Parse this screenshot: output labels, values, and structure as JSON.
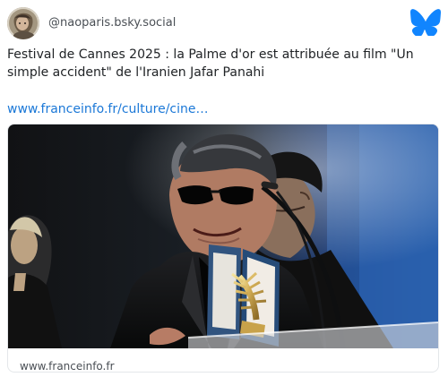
{
  "post": {
    "handle": "@naoparis.bsky.social",
    "text": "Festival de Cannes 2025 : la Palme d'or est attribuée au film \"Un simple accident\" de l'Iranien Jafar Panahi",
    "link": "www.franceinfo.fr/culture/cine…"
  },
  "embed": {
    "domain": "www.franceinfo.fr"
  },
  "icons": {
    "avatar": "profile-photo",
    "logo": "bluesky-butterfly-icon"
  },
  "colors": {
    "link": "#1b78d7",
    "bluesky_blue": "#1185fe",
    "text": "#202326",
    "muted": "#4a4f55"
  }
}
